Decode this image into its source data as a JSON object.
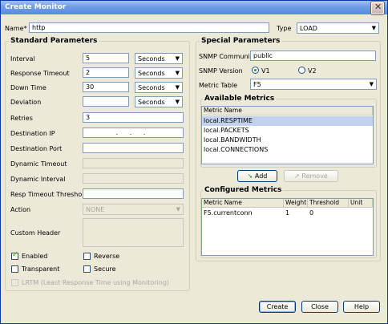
{
  "window": {
    "title": "Create Monitor"
  },
  "top": {
    "name_label": "Name*",
    "name_value": "http",
    "type_label": "Type",
    "type_value": "LOAD"
  },
  "standard": {
    "title": "Standard Parameters",
    "interval_label": "Interval",
    "interval_value": "5",
    "interval_unit": "Seconds",
    "resp_timeout_label": "Response Timeout",
    "resp_timeout_value": "2",
    "resp_timeout_unit": "Seconds",
    "down_time_label": "Down Time",
    "down_time_value": "30",
    "down_time_unit": "Seconds",
    "deviation_label": "Deviation",
    "deviation_value": "",
    "deviation_unit": "Seconds",
    "retries_label": "Retries",
    "retries_value": "3",
    "dest_ip_label": "Destination IP",
    "dest_ip_value": ".  .  .",
    "dest_port_label": "Destination Port",
    "dyn_timeout_label": "Dynamic Timeout",
    "dyn_interval_label": "Dynamic Interval",
    "resp_threshold_label": "Resp Timeout Threshold",
    "action_label": "Action",
    "action_value": "NONE",
    "custom_header_label": "Custom Header",
    "enabled_label": "Enabled",
    "enabled_checked": true,
    "reverse_label": "Reverse",
    "reverse_checked": false,
    "transparent_label": "Transparent",
    "transparent_checked": false,
    "secure_label": "Secure",
    "secure_checked": false,
    "lrtm_label": "LRTM (Least Response Time using Monitoring)",
    "lrtm_checked": false
  },
  "special": {
    "title": "Special Parameters",
    "community_label": "SNMP Community",
    "community_value": "public",
    "version_label": "SNMP Version",
    "v1_label": "V1",
    "v2_label": "V2",
    "selected_version": "V1",
    "metric_table_label": "Metric Table",
    "metric_table_value": "F5"
  },
  "available": {
    "title": "Available Metrics",
    "column": "Metric Name",
    "rows": [
      "local.RESPTIME",
      "local.PACKETS",
      "local.BANDWIDTH",
      "local.CONNECTIONS"
    ],
    "selected_index": 0
  },
  "buttons": {
    "add": "Add",
    "remove": "Remove",
    "create": "Create",
    "close": "Close",
    "help": "Help"
  },
  "configured": {
    "title": "Configured Metrics",
    "columns": [
      "Metric Name",
      "Weight",
      "Threshold",
      "Unit"
    ],
    "rows": [
      {
        "name": "F5.currentconn",
        "weight": "1",
        "threshold": "0",
        "unit": ""
      }
    ]
  },
  "icons": {
    "close": "close-icon",
    "dropdown": "chevron-down-icon",
    "add": "add-arrow-icon",
    "remove": "remove-arrow-icon"
  },
  "colors": {
    "titlebar": "#5b89e0",
    "dialog_bg": "#ece9d8",
    "selection": "#c1d2ee",
    "check": "#21a121"
  }
}
